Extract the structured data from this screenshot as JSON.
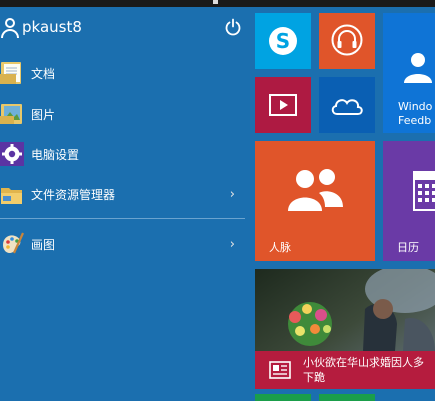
{
  "user": {
    "name": "pkaust8"
  },
  "menu": {
    "items": [
      {
        "label": "文档",
        "icon": "documents-icon"
      },
      {
        "label": "图片",
        "icon": "pictures-icon"
      },
      {
        "label": "电脑设置",
        "icon": "settings-gear-icon"
      },
      {
        "label": "文件资源管理器",
        "icon": "file-explorer-icon",
        "chevron": "›"
      },
      {
        "label": "画图",
        "icon": "paint-icon",
        "chevron": "›"
      }
    ]
  },
  "tiles": {
    "people_label": "人脉",
    "calendar_label": "日历",
    "windows_feedback_line1": "Windo",
    "windows_feedback_line2": "Feedb",
    "news_headline_line1": "小伙欲在华山求婚因人多",
    "news_headline_line2": "下跪"
  },
  "colors": {
    "start_bg": "#1b6faf",
    "skype": "#00a3e2",
    "music": "#e0552a",
    "video": "#ae1a42",
    "onedrive": "#0a5fb3",
    "people": "#e0552a",
    "calendar": "#6a3aa6",
    "feedback": "#0f74d6",
    "news_bar": "#b51c3e"
  }
}
